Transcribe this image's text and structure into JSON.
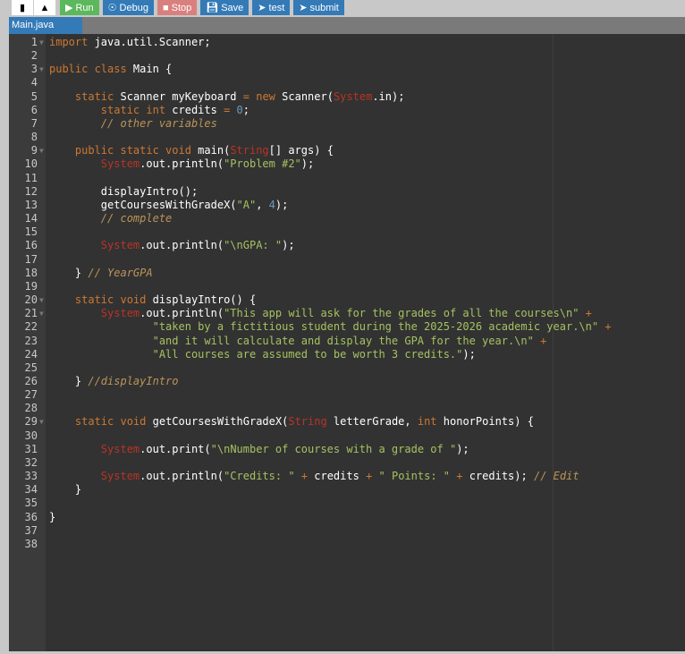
{
  "toolbar": {
    "new_icon": "file-icon",
    "upload_icon": "upload-icon",
    "run": "Run",
    "debug": "Debug",
    "stop": "Stop",
    "save": "Save",
    "test": "test",
    "submit": "submit"
  },
  "tabs": [
    {
      "label": "Main.java"
    }
  ],
  "code": [
    [
      [
        "keyword",
        "import"
      ],
      [
        "plain",
        " java.util.Scanner;"
      ]
    ],
    [],
    [
      [
        "keyword",
        "public class"
      ],
      [
        "plain",
        " Main {"
      ]
    ],
    [],
    [
      [
        "plain",
        "    "
      ],
      [
        "keyword",
        "static"
      ],
      [
        "plain",
        " Scanner myKeyboard "
      ],
      [
        "keyword",
        "="
      ],
      [
        "plain",
        " "
      ],
      [
        "keyword",
        "new"
      ],
      [
        "plain",
        " Scanner("
      ],
      [
        "class",
        "System"
      ],
      [
        "plain",
        ".in);"
      ]
    ],
    [
      [
        "plain",
        "        "
      ],
      [
        "keyword",
        "static int"
      ],
      [
        "plain",
        " credits "
      ],
      [
        "keyword",
        "="
      ],
      [
        "plain",
        " "
      ],
      [
        "number",
        "0"
      ],
      [
        "plain",
        ";"
      ]
    ],
    [
      [
        "plain",
        "        "
      ],
      [
        "comment",
        "// other variables"
      ]
    ],
    [],
    [
      [
        "plain",
        "    "
      ],
      [
        "keyword",
        "public static void"
      ],
      [
        "plain",
        " main("
      ],
      [
        "class",
        "String"
      ],
      [
        "plain",
        "[] args) {"
      ]
    ],
    [
      [
        "plain",
        "        "
      ],
      [
        "class",
        "System"
      ],
      [
        "plain",
        ".out.println("
      ],
      [
        "string",
        "\"Problem #2\""
      ],
      [
        "plain",
        ");"
      ]
    ],
    [],
    [
      [
        "plain",
        "        displayIntro();"
      ]
    ],
    [
      [
        "plain",
        "        getCoursesWithGradeX("
      ],
      [
        "string",
        "\"A\""
      ],
      [
        "plain",
        ", "
      ],
      [
        "number",
        "4"
      ],
      [
        "plain",
        ");"
      ]
    ],
    [
      [
        "plain",
        "        "
      ],
      [
        "comment",
        "// complete"
      ]
    ],
    [],
    [
      [
        "plain",
        "        "
      ],
      [
        "class",
        "System"
      ],
      [
        "plain",
        ".out.println("
      ],
      [
        "string",
        "\"\\nGPA: \""
      ],
      [
        "plain",
        ");"
      ]
    ],
    [],
    [
      [
        "plain",
        "    } "
      ],
      [
        "comment",
        "// YearGPA"
      ]
    ],
    [],
    [
      [
        "plain",
        "    "
      ],
      [
        "keyword",
        "static void"
      ],
      [
        "plain",
        " displayIntro() {"
      ]
    ],
    [
      [
        "plain",
        "        "
      ],
      [
        "class",
        "System"
      ],
      [
        "plain",
        ".out.println("
      ],
      [
        "string",
        "\"This app will ask for the grades of all the courses\\n\""
      ],
      [
        "plain",
        " "
      ],
      [
        "keyword",
        "+"
      ]
    ],
    [
      [
        "plain",
        "                "
      ],
      [
        "string",
        "\"taken by a fictitious student during the 2025-2026 academic year.\\n\""
      ],
      [
        "plain",
        " "
      ],
      [
        "keyword",
        "+"
      ]
    ],
    [
      [
        "plain",
        "                "
      ],
      [
        "string",
        "\"and it will calculate and display the GPA for the year.\\n\""
      ],
      [
        "plain",
        " "
      ],
      [
        "keyword",
        "+"
      ]
    ],
    [
      [
        "plain",
        "                "
      ],
      [
        "string",
        "\"All courses are assumed to be worth 3 credits.\""
      ],
      [
        "plain",
        ");"
      ]
    ],
    [],
    [
      [
        "plain",
        "    } "
      ],
      [
        "comment",
        "//displayIntro"
      ]
    ],
    [],
    [],
    [
      [
        "plain",
        "    "
      ],
      [
        "keyword",
        "static void"
      ],
      [
        "plain",
        " getCoursesWithGradeX("
      ],
      [
        "class",
        "String"
      ],
      [
        "plain",
        " letterGrade, "
      ],
      [
        "keyword",
        "int"
      ],
      [
        "plain",
        " honorPoints) {"
      ]
    ],
    [],
    [
      [
        "plain",
        "        "
      ],
      [
        "class",
        "System"
      ],
      [
        "plain",
        ".out.print("
      ],
      [
        "string",
        "\"\\nNumber of courses with a grade of \""
      ],
      [
        "plain",
        ");"
      ]
    ],
    [],
    [
      [
        "plain",
        "        "
      ],
      [
        "class",
        "System"
      ],
      [
        "plain",
        ".out.println("
      ],
      [
        "string",
        "\"Credits: \""
      ],
      [
        "plain",
        " "
      ],
      [
        "keyword",
        "+"
      ],
      [
        "plain",
        " credits "
      ],
      [
        "keyword",
        "+"
      ],
      [
        "plain",
        " "
      ],
      [
        "string",
        "\" Points: \""
      ],
      [
        "plain",
        " "
      ],
      [
        "keyword",
        "+"
      ],
      [
        "plain",
        " credits); "
      ],
      [
        "comment",
        "// Edit"
      ]
    ],
    [
      [
        "plain",
        "    }"
      ]
    ],
    [],
    [
      [
        "plain",
        "}"
      ]
    ],
    [],
    []
  ],
  "foldable_lines": [
    1,
    3,
    9,
    20,
    21,
    29
  ]
}
